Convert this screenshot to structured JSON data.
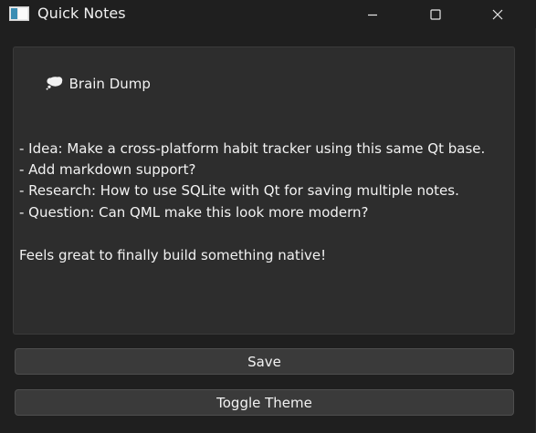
{
  "window": {
    "title": "Quick Notes",
    "app_icon": "notepad-icon",
    "controls": {
      "minimize": "minimize-icon",
      "maximize": "maximize-icon",
      "close": "close-icon"
    }
  },
  "editor": {
    "heading_icon": "thought-bubble-icon",
    "lines": [
      "Brain Dump",
      "",
      "- Idea: Make a cross-platform habit tracker using this same Qt base.",
      "- Add markdown support?",
      "- Research: How to use SQLite with Qt for saving multiple notes.",
      "- Question: Can QML make this look more modern?",
      "",
      "Feels great to finally build something native!"
    ]
  },
  "buttons": {
    "save_label": "Save",
    "toggle_theme_label": "Toggle Theme"
  },
  "colors": {
    "window_bg": "#1f1f1f",
    "editor_bg": "#2d2d2d",
    "button_bg": "#3a3a3a",
    "text": "#f2f2f2"
  }
}
